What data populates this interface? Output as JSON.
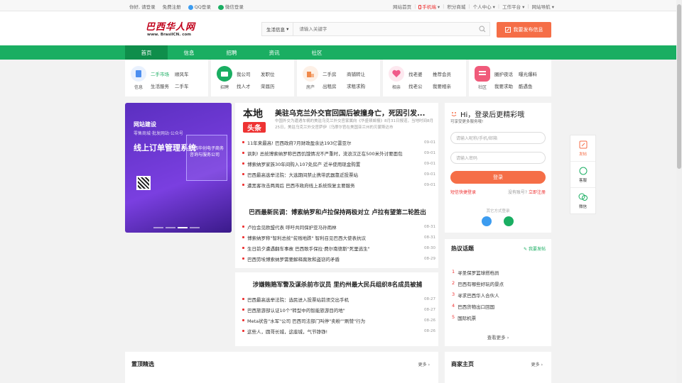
{
  "topbar": {
    "greeting": "你好,",
    "login": "请登录",
    "register": "免费注册",
    "qq_login": "QQ登录",
    "wechat_login": "微信登录",
    "right": [
      "网站首页",
      "手机端",
      "积分商城",
      "个人中心",
      "工作平台",
      "网站导航"
    ]
  },
  "header": {
    "logo_text": "巴西华人网",
    "logo_sub": "www. BrasilCN. com",
    "search_category": "生活信息",
    "search_placeholder": "请输入关键字",
    "publish_button": "我要发布信息"
  },
  "nav": {
    "items": [
      "首页",
      "信息",
      "招聘",
      "资讯",
      "社区"
    ],
    "active": 0
  },
  "categories": [
    {
      "name": "信息",
      "color": "#4d8ff0",
      "links": [
        "二手市场",
        "顺风车",
        "生活服务",
        "二手车"
      ]
    },
    {
      "name": "招聘",
      "color": "#1aae62",
      "links": [
        "我公司",
        "发职位",
        "找人才",
        "荣届历"
      ]
    },
    {
      "name": "房产",
      "color": "#f08a4b",
      "links": [
        "二手房",
        "商铺转让",
        "出租房",
        "求租求购"
      ]
    },
    {
      "name": "相亲",
      "color": "#f05a8a",
      "links": [
        "找老婆",
        "推荐会员",
        "找老公",
        "我要相亲"
      ]
    },
    {
      "name": "社区",
      "color": "#f05a7a",
      "links": [
        "圈护夜话",
        "曝光爆料",
        "我要求助",
        "酷遇鱼"
      ]
    }
  ],
  "banner": {
    "line1": "网站建设",
    "line2": "零售商城·批发网站·公众号",
    "line3": "线上订单管理系统",
    "box_title": "巴西华创电子商务咨询与服务公司"
  },
  "news": {
    "badge_top": "本地",
    "badge_bottom": "头条",
    "headline": "美驻乌克兰外交官回国后被撞身亡，死因引发...",
    "summary": "中国外交为遭遇车祸的美驻乌克兰外交官家属向《华盛顿邮报》8月31日报道，当地时间8月25日，美驻乌克兰外交官萨伊（乌摩尔官在美国亚兰州的贝蒙斯达市",
    "list1": [
      {
        "text": "11年来最高! 巴西政府7月财政盈余达193亿雷亚尔",
        "date": "09-01"
      },
      {
        "text": "讽刺! 总统博索纳罗称巴西饥饿情况不严重时，流浪汉正在500米外讨要面包",
        "date": "09-01"
      },
      {
        "text": "博索纳罗家族30年间购入107处房产 近半使用现金购置",
        "date": "09-01"
      },
      {
        "text": "巴西最高选举法院：大选期间禁止携带武器靠近投票站",
        "date": "09-01"
      },
      {
        "text": "遭黑客攻击两周后 巴西市政府线上系统恢复主要服务",
        "date": "09-01"
      }
    ],
    "section2": "巴西最新民调：博索纳罗和卢拉保持两极对立 卢拉有望第二轮胜出",
    "list2": [
      {
        "text": "卢拉会见欧盟代表 呼吁共同保护亚马孙雨林",
        "date": "08-31"
      },
      {
        "text": "博索纳罗称\"智利总统\"贫贱地跌\" 智利召见巴西大使表抗议",
        "date": "08-31"
      },
      {
        "text": "生日前夕遭遇翻车事故 巴西歌手保拉·费尔南德斯\"死里逃生\"",
        "date": "08-30"
      },
      {
        "text": "巴西劳埃博索纳罗需要解释腐败和盗窃的矛盾",
        "date": "08-29"
      }
    ],
    "section3": "涉嫌贿赂军警及谋杀前市议员 里约州最大民兵组织8名成员被捕",
    "list3": [
      {
        "text": "巴西最高选举法院：选民进入投票站前须交出手机",
        "date": "08-27"
      },
      {
        "text": "巴西旅游部认证10个\"转型中的智能旅游目的地\"",
        "date": "08-27"
      },
      {
        "text": "Meta状告\"水军\"公司 巴西司法部门叫停\"卖粉\"\"刷赞\"行为",
        "date": "08-26"
      },
      {
        "text": "这些人，圆哥长城，这座城，气节铮铮!",
        "date": "08-26"
      }
    ]
  },
  "login": {
    "greeting": "Hi，登录后更精彩哦",
    "sub": "可享受更多服务哦!",
    "username_placeholder": "请输入昵称/手机/邮箱",
    "password_placeholder": "请输入密码",
    "login_button": "登录",
    "quick_login": "短信快捷登录",
    "no_account": "没有账号?",
    "register_now": "立即注册",
    "other_methods": "其它方式登录"
  },
  "hot": {
    "title": "热议话题",
    "publish": "我要发帖",
    "items": [
      "寻圣保罗篮球搭档员",
      "巴西有哪些好玩的景点",
      "寻求巴西华人合伙人",
      "巴西货物出口回国",
      "国际机票"
    ],
    "more": "查看更多"
  },
  "side": [
    "发帖",
    "客服",
    "微信"
  ],
  "bottom": {
    "left_title": "置顶精选",
    "left_more": "更多",
    "right_title": "商家主页",
    "right_more": "更多"
  }
}
